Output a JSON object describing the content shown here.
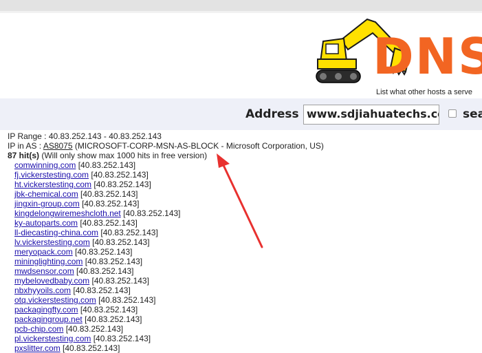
{
  "header": {
    "logo_text": "DNS",
    "tagline": "List what other hosts a serve"
  },
  "search": {
    "label": "Address :",
    "value": "www.sdjiahuatechs.com",
    "checkbox_label": "sea"
  },
  "results": {
    "ip_range_label": "IP Range :",
    "ip_range_value": "40.83.252.143 - 40.83.252.143",
    "ip_in_as_label": "IP in AS :",
    "as_number": "AS8075",
    "as_description": "(MICROSOFT-CORP-MSN-AS-BLOCK - Microsoft Corporation, US)",
    "hits_count": "87 hit(s)",
    "hits_note": "(Will only show max 1000 hits in free version)",
    "hosts": [
      {
        "name": "comwinning.com",
        "ip": "[40.83.252.143]"
      },
      {
        "name": "fj.vickerstesting.com",
        "ip": "[40.83.252.143]"
      },
      {
        "name": "ht.vickerstesting.com",
        "ip": "[40.83.252.143]"
      },
      {
        "name": "jbk-chemical.com",
        "ip": "[40.83.252.143]"
      },
      {
        "name": "jingxin-group.com",
        "ip": "[40.83.252.143]"
      },
      {
        "name": "kingdelongwiremeshcloth.net",
        "ip": "[40.83.252.143]"
      },
      {
        "name": "ky-autoparts.com",
        "ip": "[40.83.252.143]"
      },
      {
        "name": "ll-diecasting-china.com",
        "ip": "[40.83.252.143]"
      },
      {
        "name": "lv.vickerstesting.com",
        "ip": "[40.83.252.143]"
      },
      {
        "name": "meryopack.com",
        "ip": "[40.83.252.143]"
      },
      {
        "name": "mininglighting.com",
        "ip": "[40.83.252.143]"
      },
      {
        "name": "mwdsensor.com",
        "ip": "[40.83.252.143]"
      },
      {
        "name": "mybelovedbaby.com",
        "ip": "[40.83.252.143]"
      },
      {
        "name": "nbxhyyoils.com",
        "ip": "[40.83.252.143]"
      },
      {
        "name": "otq.vickerstesting.com",
        "ip": "[40.83.252.143]"
      },
      {
        "name": "packagingfty.com",
        "ip": "[40.83.252.143]"
      },
      {
        "name": "packagingroup.net",
        "ip": "[40.83.252.143]"
      },
      {
        "name": "pcb-chip.com",
        "ip": "[40.83.252.143]"
      },
      {
        "name": "pl.vickerstesting.com",
        "ip": "[40.83.252.143]"
      },
      {
        "name": "pxslitter.com",
        "ip": "[40.83.252.143]"
      }
    ]
  },
  "colors": {
    "logo": "#f26522",
    "excavator": "#ffe000",
    "link": "#1a0dab",
    "annotation_arrow": "#e8312f",
    "search_bar_bg": "#eef0f8"
  },
  "icons": {
    "logo_graphic": "excavator-icon",
    "annotation": "red-arrow"
  }
}
